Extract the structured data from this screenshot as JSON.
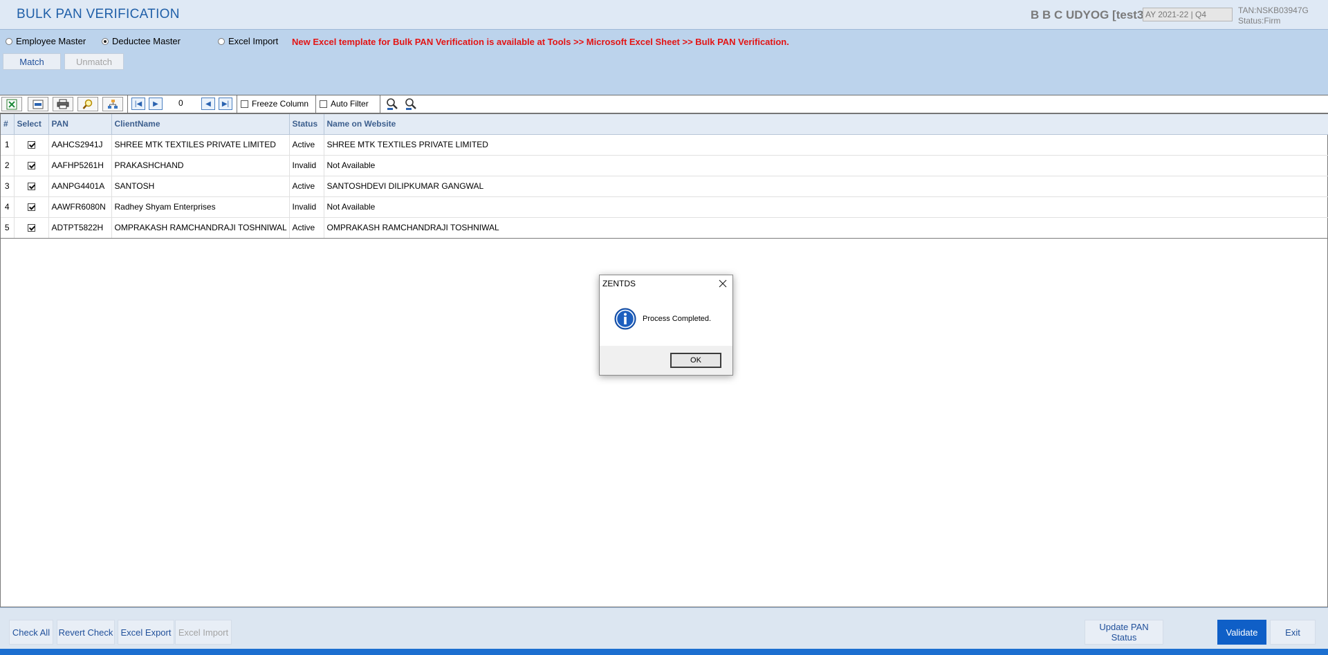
{
  "header": {
    "title": "BULK PAN VERIFICATION",
    "company": "B B C UDYOG [test3]",
    "assessment_year": "AY 2021-22 | Q4",
    "tan": "TAN:NSKB03947G",
    "status": "Status:Firm"
  },
  "options": {
    "radios": [
      {
        "label": "Employee Master",
        "selected": false
      },
      {
        "label": "Deductee Master",
        "selected": true
      },
      {
        "label": "Excel Import",
        "selected": false
      }
    ],
    "notice": "New Excel template for Bulk PAN Verification is available at Tools >> Microsoft Excel Sheet >> Bulk PAN Verification."
  },
  "actions": {
    "match_label": "Match",
    "unmatch_label": "Unmatch"
  },
  "toolbar": {
    "record_counter": "0",
    "freeze_column_label": "Freeze Column",
    "auto_filter_label": "Auto Filter"
  },
  "grid": {
    "columns": [
      "#",
      "Select",
      "PAN",
      "ClientName",
      "Status",
      "Name on Website"
    ],
    "rows": [
      {
        "num": "1",
        "selected": true,
        "pan": "AAHCS2941J",
        "client": "SHREE MTK TEXTILES PRIVATE LIMITED",
        "status": "Active",
        "website_name": "SHREE MTK TEXTILES PRIVATE LIMITED"
      },
      {
        "num": "2",
        "selected": true,
        "pan": "AAFHP5261H",
        "client": "PRAKASHCHAND",
        "status": "Invalid",
        "website_name": "Not Available"
      },
      {
        "num": "3",
        "selected": true,
        "pan": "AANPG4401A",
        "client": "SANTOSH",
        "status": "Active",
        "website_name": "SANTOSHDEVI DILIPKUMAR GANGWAL"
      },
      {
        "num": "4",
        "selected": true,
        "pan": "AAWFR6080N",
        "client": "Radhey Shyam Enterprises",
        "status": "Invalid",
        "website_name": "Not Available"
      },
      {
        "num": "5",
        "selected": true,
        "pan": "ADTPT5822H",
        "client": "OMPRAKASH RAMCHANDRAJI TOSHNIWAL",
        "status": "Active",
        "website_name": "OMPRAKASH RAMCHANDRAJI TOSHNIWAL"
      }
    ]
  },
  "dialog": {
    "title": "ZENTDS",
    "message": "Process Completed.",
    "ok_label": "OK"
  },
  "footer": {
    "check_all": "Check All",
    "revert_check": "Revert Check",
    "excel_export": "Excel Export",
    "excel_import": "Excel Import",
    "update_pan_line1": "Update PAN",
    "update_pan_line2": "Status",
    "validate": "Validate",
    "exit": "Exit"
  },
  "colors": {
    "accent": "#0f5fc7",
    "notice": "#e31414",
    "header_bg": "#dfe9f5",
    "panel_bg": "#bcd3ec"
  },
  "icons": [
    "excel-icon",
    "pdf-icon",
    "printer-icon",
    "search-icon",
    "chart-icon",
    "first-record-icon",
    "prev-record-icon",
    "next-record-icon",
    "last-record-icon",
    "find-icon",
    "find-next-icon",
    "info-icon",
    "close-icon"
  ]
}
